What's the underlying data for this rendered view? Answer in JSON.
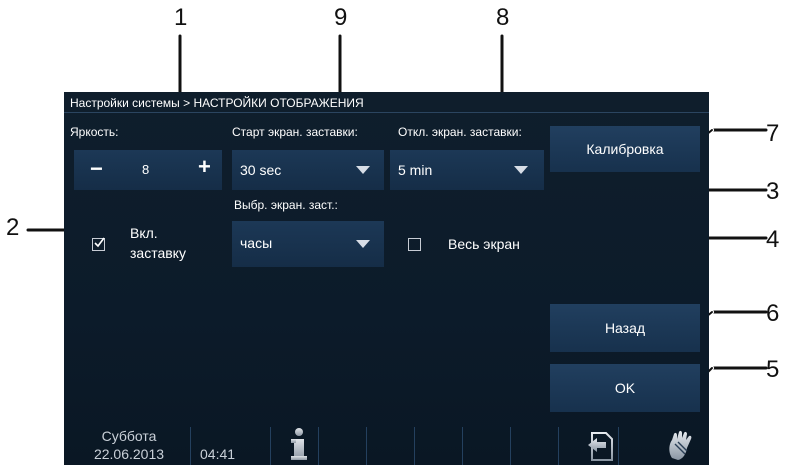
{
  "callouts": [
    "1",
    "9",
    "8",
    "7",
    "3",
    "2",
    "4",
    "6",
    "5"
  ],
  "breadcrumb": "Настройки системы > НАСТРОЙКИ ОТОБРАЖЕНИЯ",
  "brightness": {
    "label": "Яркость:",
    "value": "8",
    "minus": "−",
    "plus": "+"
  },
  "screensaver_start": {
    "label": "Старт экран. заставки:",
    "value": "30 sec"
  },
  "screen_off": {
    "label": "Откл. экран. заставки:",
    "value": "5 min"
  },
  "calibration_label": "Калибровка",
  "screensaver_choice": {
    "label": "Выбр. экран. заст.:",
    "value": "часы"
  },
  "enable_screensaver": {
    "line1": "Вкл.",
    "line2": "заставку",
    "checked": true
  },
  "fullscreen": {
    "label": "Весь экран",
    "checked": false
  },
  "back_label": "Назад",
  "ok_label": "OK",
  "status": {
    "day": "Суббота",
    "date": "22.06.2013",
    "time": "04:41"
  },
  "colors": {
    "screen_bg": "#0e1d2b",
    "panel": "#1a3452",
    "text": "#ffffff"
  }
}
